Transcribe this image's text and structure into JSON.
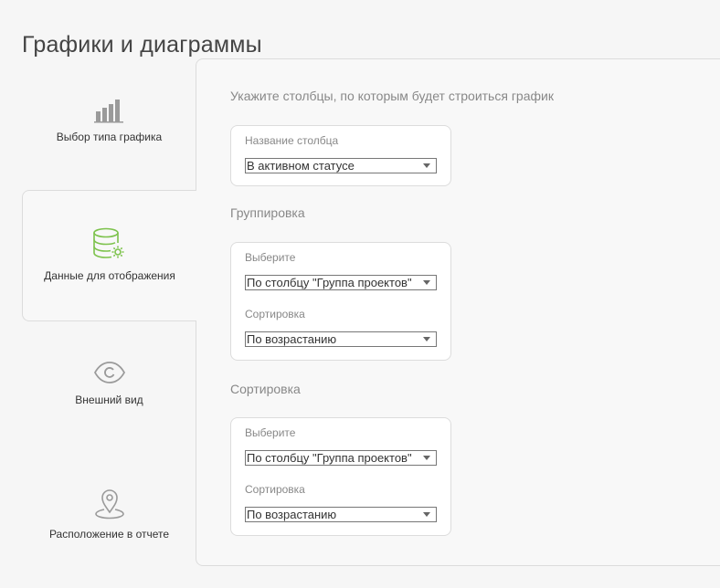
{
  "page": {
    "title": "Графики и диаграммы"
  },
  "steps": [
    {
      "label": "Выбор типа графика",
      "icon": "bar-chart-icon"
    },
    {
      "label": "Данные для отображения",
      "icon": "database-gear-icon",
      "active": true
    },
    {
      "label": "Внешний вид",
      "icon": "eye-icon"
    },
    {
      "label": "Расположение в отчете",
      "icon": "location-pin-icon"
    }
  ],
  "colors": {
    "accent": "#7cc24b",
    "icon_gray": "#9a9a9a"
  },
  "columns_section": {
    "title": "Укажите столбцы, по которым будет строиться график",
    "field_label": "Название столбца",
    "value": "В активном статусе"
  },
  "grouping": {
    "title": "Группировка",
    "select_label": "Выберите",
    "select_value": "По столбцу \"Группа проектов\"",
    "sort_label": "Сортировка",
    "sort_value": "По возрастанию"
  },
  "sorting": {
    "title": "Сортировка",
    "select_label": "Выберите",
    "select_value": "По столбцу \"Группа проектов\"",
    "sort_label": "Сортировка",
    "sort_value": "По возрастанию"
  }
}
